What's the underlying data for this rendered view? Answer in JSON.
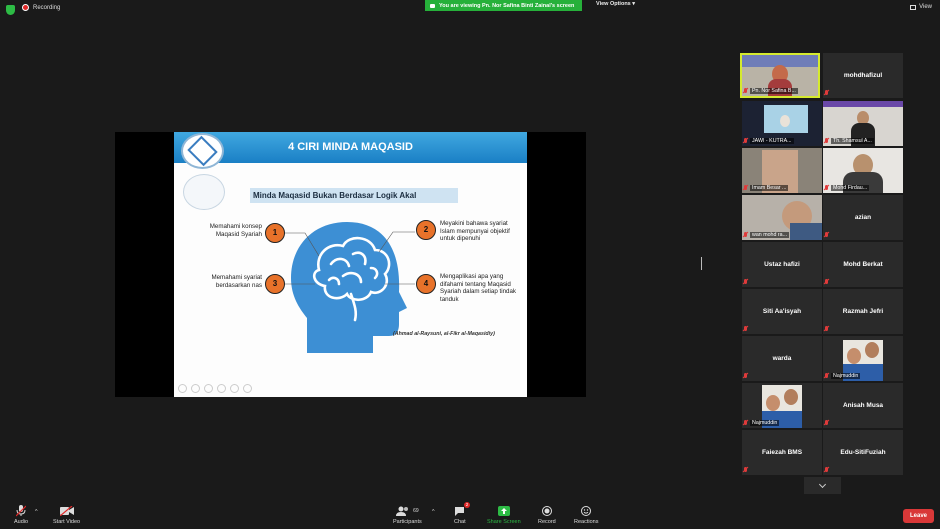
{
  "topbar": {
    "recording_label": "Recording",
    "viewing_banner": "You are viewing Pn. Nor Safina Binti Zainal's screen",
    "view_options": "View Options",
    "view_label": "View"
  },
  "slide": {
    "title": "4 CIRI MINDA MAQASID",
    "subtitle": "Minda Maqasid Bukan Berdasar Logik Akal",
    "points": [
      {
        "num": "1",
        "text": "Memahami konsep Maqasid Syariah"
      },
      {
        "num": "2",
        "text": "Meyakini bahawa syariat Islam mempunyai objektif untuk dipenuhi"
      },
      {
        "num": "3",
        "text": "Memahami syariat berdasarkan nas"
      },
      {
        "num": "4",
        "text": "Mengaplikasi apa yang difahami tentang Maqasid Syariah dalam setiap tindak tanduk"
      }
    ],
    "citation": "(Ahmad al-Raysuni, al-Fikr al-Maqasidiy)",
    "colors": {
      "header": "#1a7fc5",
      "number_circle": "#e8722a",
      "head": "#3d8fd4"
    }
  },
  "participants": [
    {
      "name": "Pn. Nor Safina B...",
      "type": "video"
    },
    {
      "name": "mohdhafizul",
      "type": "name"
    },
    {
      "name": "JAWI - KUTRA...",
      "type": "video"
    },
    {
      "name": "Th. Shamsul A...",
      "type": "video"
    },
    {
      "name": "Imam Besar ...",
      "type": "video"
    },
    {
      "name": "Mohd Firdau...",
      "type": "video"
    },
    {
      "name": "wan mohd ra...",
      "type": "video"
    },
    {
      "name": "azian",
      "type": "name"
    },
    {
      "name": "Ustaz hafizi",
      "type": "name"
    },
    {
      "name": "Mohd Berkat",
      "type": "name"
    },
    {
      "name": "Siti Aa'isyah",
      "type": "name"
    },
    {
      "name": "Razmah Jefri",
      "type": "name"
    },
    {
      "name": "warda",
      "type": "name"
    },
    {
      "name": "Najmuddin",
      "type": "video"
    },
    {
      "name": "Najmuddin",
      "type": "video"
    },
    {
      "name": "Anisah Musa",
      "type": "name"
    },
    {
      "name": "Faiezah BMS",
      "type": "name"
    },
    {
      "name": "Edu-SitiFuziah",
      "type": "name"
    }
  ],
  "toolbar": {
    "audio": "Audio",
    "start_video": "Start Video",
    "participants": "Participants",
    "participants_count": "69",
    "chat": "Chat",
    "chat_badge": "2",
    "share_screen": "Share Screen",
    "record": "Record",
    "reactions": "Reactions",
    "leave": "Leave"
  }
}
